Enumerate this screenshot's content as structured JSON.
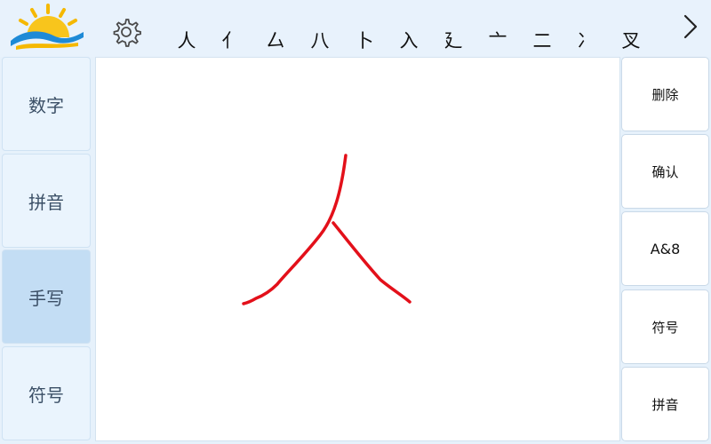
{
  "candidates": [
    "人",
    "亻",
    "厶",
    "八",
    "卜",
    "入",
    "廴",
    "亠",
    "二",
    "冫",
    "叉"
  ],
  "left_tabs": [
    "数字",
    "拼音",
    "手写",
    "符号"
  ],
  "active_tab": "手写",
  "right_buttons": [
    "删除",
    "确认",
    "A&8",
    "符号",
    "拼音"
  ],
  "colors": {
    "stroke": "#e3101a",
    "active_tab_bg": "#c3ddf4",
    "tab_bg": "#eaf4fd"
  },
  "icons": {
    "settings": "gear-icon",
    "more": "chevron-right-icon",
    "logo": "sun-logo-icon"
  }
}
